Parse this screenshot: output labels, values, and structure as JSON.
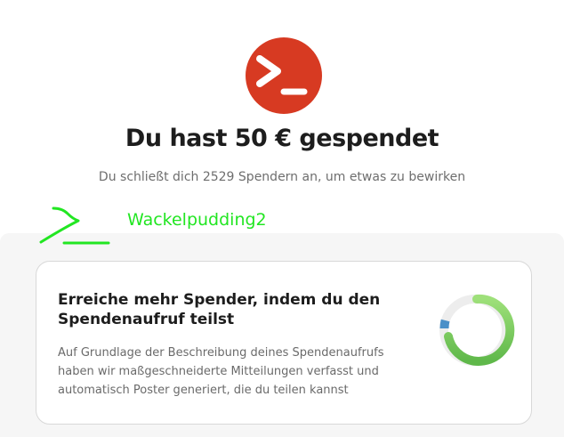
{
  "header": {
    "logo_icon": "terminal-prompt-icon",
    "title": "Du hast 50 € gespendet",
    "subtitle": "Du schließt dich 2529 Spendern an, um etwas zu bewirken"
  },
  "overlay": {
    "mark_icon": "prompt-scribble-icon",
    "name": "Wackelpudding2",
    "color": "#22e622"
  },
  "share_card": {
    "heading": "Erreiche mehr Spender, indem du den Spendenaufruf teilst",
    "body": "Auf Grundlage der Beschreibung deines Spendenaufrufs haben wir maßgeschneiderte Mitteilungen verfasst und automatisch Poster generiert, die du teilen kannst",
    "graphic_icon": "progress-ring-icon"
  },
  "colors": {
    "brand_red": "#d73a22",
    "ring_green": "#6cc84a",
    "ring_blue": "#4a90c8"
  }
}
